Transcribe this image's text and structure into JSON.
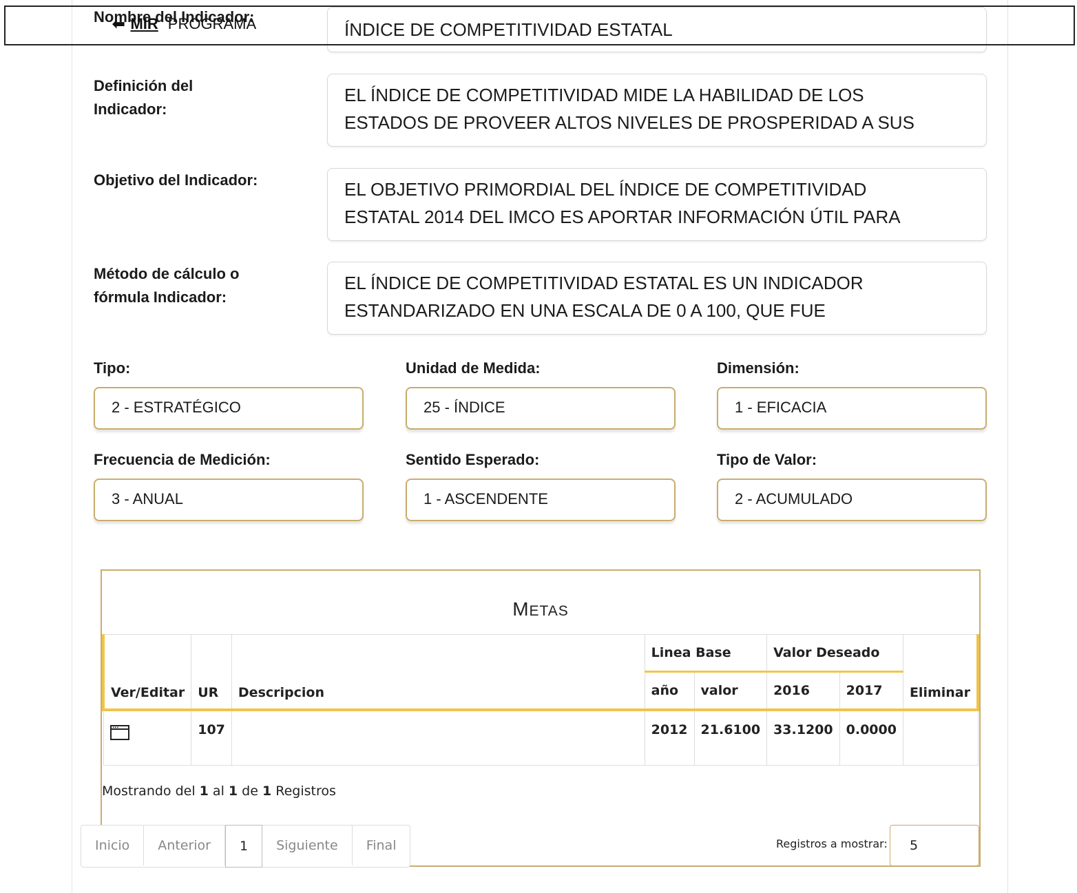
{
  "nav": {
    "back_icon": "arrow-left-icon",
    "mir": "MIR",
    "programa": "PROGRAMA"
  },
  "form": {
    "nombre_label": "Nombre del Indicador:",
    "nombre_value": "ÍNDICE DE COMPETITIVIDAD ESTATAL",
    "definicion_label_1": "Definición del",
    "definicion_label_2": "Indicador:",
    "definicion_value_1": "EL ÍNDICE DE COMPETITIVIDAD MIDE LA HABILIDAD DE LOS",
    "definicion_value_2": "ESTADOS DE PROVEER ALTOS NIVELES DE PROSPERIDAD A SUS",
    "objetivo_label": "Objetivo del Indicador:",
    "objetivo_value_1": "EL OBJETIVO PRIMORDIAL DEL ÍNDICE DE COMPETITIVIDAD",
    "objetivo_value_2": "ESTATAL 2014 DEL IMCO ES APORTAR INFORMACIÓN ÚTIL PARA",
    "metodo_label_1": "Método de cálculo o",
    "metodo_label_2": "fórmula Indicador:",
    "metodo_value_1": "EL ÍNDICE DE COMPETITIVIDAD ESTATAL ES UN INDICADOR",
    "metodo_value_2": "ESTANDARIZADO EN UNA ESCALA DE 0 A 100, QUE FUE",
    "tipo_label": "Tipo:",
    "tipo_value": "2 - ESTRATÉGICO",
    "unidad_label": "Unidad de Medida:",
    "unidad_value": "25 - ÍNDICE",
    "dimension_label": "Dimensión:",
    "dimension_value": "1 - EFICACIA",
    "frecuencia_label": "Frecuencia de Medición:",
    "frecuencia_value": "3 - ANUAL",
    "sentido_label": "Sentido Esperado:",
    "sentido_value": "1 - ASCENDENTE",
    "tipo_valor_label": "Tipo de Valor:",
    "tipo_valor_value": "2 - ACUMULADO"
  },
  "metas": {
    "title_big": "M",
    "title_rest": "ETAS",
    "headers": {
      "ver_editar": "Ver/Editar",
      "ur": "UR",
      "descripcion": "Descripcion",
      "linea_base": "Linea Base",
      "valor_deseado": "Valor Deseado",
      "anio": "año",
      "valor": "valor",
      "y2016": "2016",
      "y2017": "2017",
      "eliminar": "Eliminar"
    },
    "rows": [
      {
        "edit_icon": "window-icon",
        "ur": "107",
        "descripcion": "",
        "anio": "2012",
        "valor": "21.6100",
        "v2016": "33.1200",
        "v2017": "0.0000",
        "eliminar": ""
      }
    ],
    "showing_pre": "Mostrando del ",
    "showing_from": "1",
    "showing_mid1": " al ",
    "showing_to": "1",
    "showing_mid2": " de ",
    "showing_total": "1",
    "showing_post": " Registros",
    "pager": {
      "inicio": "Inicio",
      "anterior": "Anterior",
      "page": "1",
      "siguiente": "Siguiente",
      "final": "Final"
    },
    "perpage_label": "Registros a mostrar:",
    "perpage_value": "5"
  }
}
